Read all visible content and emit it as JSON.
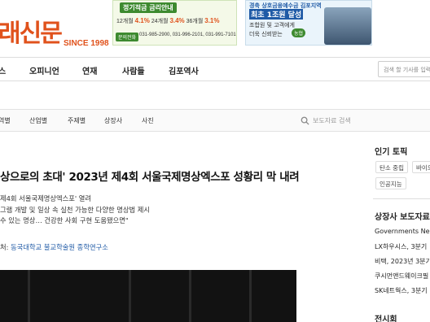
{
  "header": {
    "logo_text": "래신문",
    "logo_since": "SINCE 1998",
    "ad1": {
      "title": "정기적금 금리안내",
      "rates": [
        "12개월",
        "4.1%",
        "24개월",
        "3.4%",
        "36개월",
        "3.1%"
      ],
      "button": "문의전화",
      "phones": "031-985-2900, 031-996-2101, 031-991-7101"
    },
    "ad2": {
      "line1": "경축 상호금융예수금 김포지역",
      "line2": "최초 1조원 달성",
      "line3": "조합원 및 고객에게",
      "line4": "더욱 신뢰받는",
      "badge": "농협"
    }
  },
  "nav": {
    "items": [
      "스",
      "오피니언",
      "연재",
      "사람들",
      "김포역사"
    ],
    "search_placeholder": "검색 할 기사를 입력"
  },
  "subnav": {
    "items": [
      "역별",
      "산업별",
      "주제별",
      "상장사",
      "사진"
    ],
    "search_placeholder": "보도자료 검색"
  },
  "article": {
    "headline": "상으로의 초대' 2023년 제4회 서울국제명상엑스포 성황리 막 내려",
    "sub_lines": [
      "제4회 서울국제명상엑스포' 열려",
      "그램 개발 및 일상 속 실천 가능한 다양한 명상법 제시",
      "수 있는 명상… 건강한 사회 구현 도움됐으면\""
    ],
    "source_label": "처:",
    "source_link": "동국대학교 불교학술원 종학연구소"
  },
  "sidebar": {
    "popular_title": "인기 토픽",
    "tags": [
      "탄소 중립",
      "바이오",
      "인공지능"
    ],
    "listed_title": "상장사 보도자료",
    "links": [
      "Governments Nee",
      "LX하우시스, 3분기",
      "비택, 2023년 3분기",
      "쿠시먼앤드웨이크필",
      "SK네트웍스, 3분기"
    ],
    "exhibition_title": "전시회"
  },
  "colors": {
    "brand": "#e0521c",
    "link": "#1f5aa6"
  }
}
